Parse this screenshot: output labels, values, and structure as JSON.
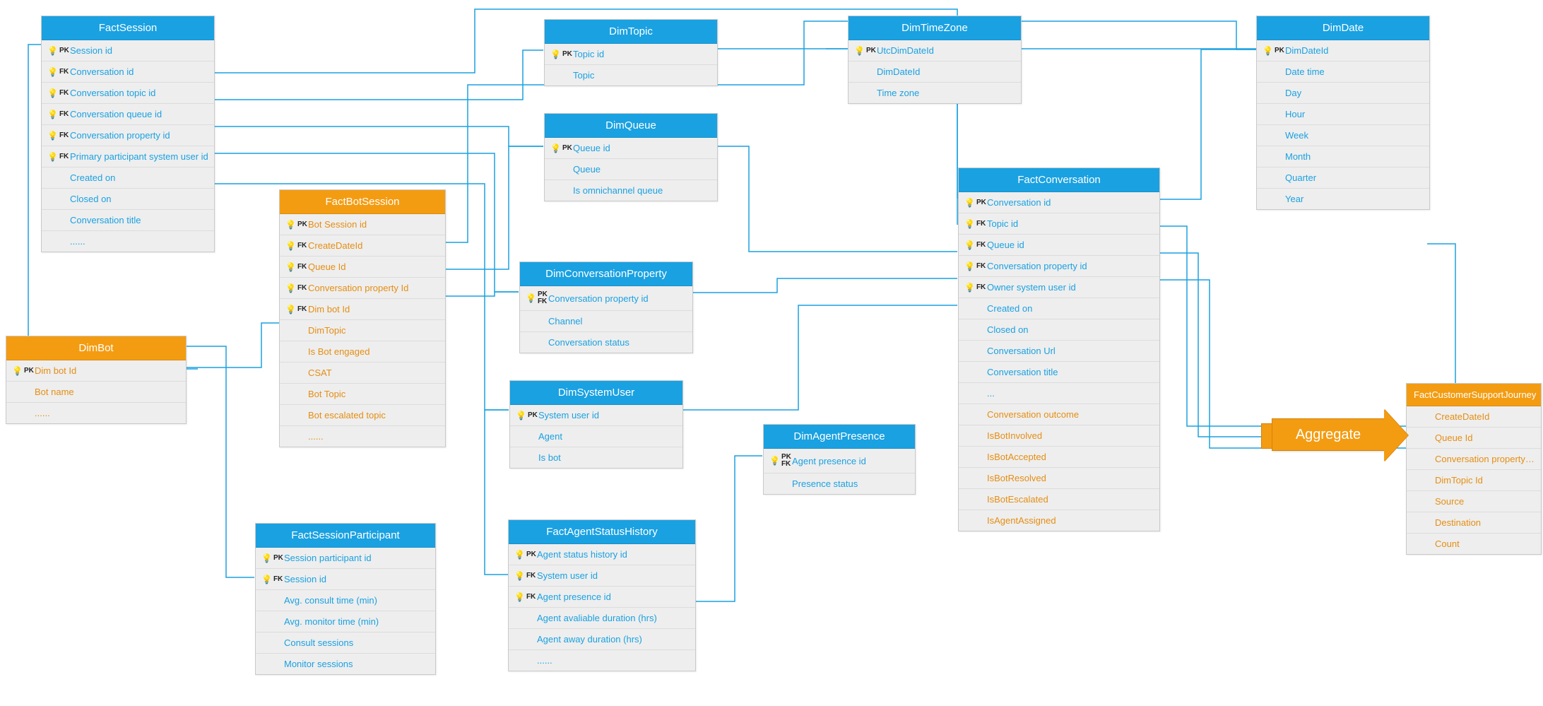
{
  "aggregate_label": "Aggregate",
  "entities": {
    "factSession": {
      "title": "FactSession",
      "color": "blue",
      "rows": [
        {
          "key": "PK",
          "label": "Session id"
        },
        {
          "key": "FK",
          "label": "Conversation id"
        },
        {
          "key": "FK",
          "label": "Conversation topic id"
        },
        {
          "key": "FK",
          "label": "Conversation queue id"
        },
        {
          "key": "FK",
          "label": "Conversation property id"
        },
        {
          "key": "FK",
          "label": "Primary participant system user id"
        },
        {
          "key": "",
          "label": "Created on"
        },
        {
          "key": "",
          "label": "Closed on"
        },
        {
          "key": "",
          "label": "Conversation title"
        },
        {
          "key": "",
          "label": "......"
        }
      ]
    },
    "dimBot": {
      "title": "DimBot",
      "color": "orange",
      "rows": [
        {
          "key": "PK",
          "label": "Dim bot Id"
        },
        {
          "key": "",
          "label": "Bot name"
        },
        {
          "key": "",
          "label": "......"
        }
      ]
    },
    "factBotSession": {
      "title": "FactBotSession",
      "color": "orange",
      "rows": [
        {
          "key": "PK",
          "label": "Bot Session id"
        },
        {
          "key": "FK",
          "label": "CreateDateId"
        },
        {
          "key": "FK",
          "label": "Queue Id"
        },
        {
          "key": "FK",
          "label": "Conversation property Id"
        },
        {
          "key": "FK",
          "label": "Dim bot Id"
        },
        {
          "key": "",
          "label": "DimTopic"
        },
        {
          "key": "",
          "label": "Is Bot engaged"
        },
        {
          "key": "",
          "label": "CSAT"
        },
        {
          "key": "",
          "label": "Bot Topic"
        },
        {
          "key": "",
          "label": "Bot escalated topic"
        },
        {
          "key": "",
          "label": "......"
        }
      ]
    },
    "factSessionParticipant": {
      "title": "FactSessionParticipant",
      "color": "blue",
      "rows": [
        {
          "key": "PK",
          "label": "Session participant id"
        },
        {
          "key": "FK",
          "label": "Session id"
        },
        {
          "key": "",
          "label": "Avg. consult time (min)"
        },
        {
          "key": "",
          "label": "Avg. monitor time (min)"
        },
        {
          "key": "",
          "label": "Consult sessions"
        },
        {
          "key": "",
          "label": "Monitor sessions"
        }
      ]
    },
    "dimTopic": {
      "title": "DimTopic",
      "color": "blue",
      "rows": [
        {
          "key": "PK",
          "label": "Topic id"
        },
        {
          "key": "",
          "label": "Topic"
        }
      ]
    },
    "dimQueue": {
      "title": "DimQueue",
      "color": "blue",
      "rows": [
        {
          "key": "PK",
          "label": "Queue id"
        },
        {
          "key": "",
          "label": "Queue"
        },
        {
          "key": "",
          "label": "Is omnichannel queue"
        }
      ]
    },
    "dimConversationProperty": {
      "title": "DimConversationProperty",
      "color": "blue",
      "rows": [
        {
          "key": "PK FK",
          "label": "Conversation property id"
        },
        {
          "key": "",
          "label": "Channel"
        },
        {
          "key": "",
          "label": "Conversation status"
        }
      ]
    },
    "dimSystemUser": {
      "title": "DimSystemUser",
      "color": "blue",
      "rows": [
        {
          "key": "PK",
          "label": "System user id"
        },
        {
          "key": "",
          "label": "Agent"
        },
        {
          "key": "",
          "label": "Is bot"
        }
      ]
    },
    "factAgentStatusHistory": {
      "title": "FactAgentStatusHistory",
      "color": "blue",
      "rows": [
        {
          "key": "PK",
          "label": "Agent status history id"
        },
        {
          "key": "FK",
          "label": "System user id"
        },
        {
          "key": "FK",
          "label": "Agent presence id"
        },
        {
          "key": "",
          "label": "Agent avaliable duration (hrs)"
        },
        {
          "key": "",
          "label": "Agent away duration (hrs)"
        },
        {
          "key": "",
          "label": "......"
        }
      ]
    },
    "dimAgentPresence": {
      "title": "DimAgentPresence",
      "color": "blue",
      "rows": [
        {
          "key": "PK FK",
          "label": "Agent presence id"
        },
        {
          "key": "",
          "label": "Presence status"
        }
      ]
    },
    "dimTimeZone": {
      "title": "DimTimeZone",
      "color": "blue",
      "rows": [
        {
          "key": "PK",
          "label": "UtcDimDateId"
        },
        {
          "key": "",
          "label": "DimDateId"
        },
        {
          "key": "",
          "label": "Time zone"
        }
      ]
    },
    "factConversation": {
      "title": "FactConversation",
      "color": "blue",
      "rows": [
        {
          "key": "PK",
          "label": "Conversation id",
          "txt": "blue"
        },
        {
          "key": "FK",
          "label": "Topic id",
          "txt": "blue"
        },
        {
          "key": "FK",
          "label": "Queue id",
          "txt": "blue"
        },
        {
          "key": "FK",
          "label": "Conversation property id",
          "txt": "blue"
        },
        {
          "key": "FK",
          "label": "Owner system user id",
          "txt": "blue"
        },
        {
          "key": "",
          "label": "Created on",
          "txt": "blue"
        },
        {
          "key": "",
          "label": "Closed on",
          "txt": "blue"
        },
        {
          "key": "",
          "label": "Conversation Url",
          "txt": "blue"
        },
        {
          "key": "",
          "label": "Conversation title",
          "txt": "blue"
        },
        {
          "key": "",
          "label": "...",
          "txt": "blue"
        },
        {
          "key": "",
          "label": "Conversation outcome",
          "txt": "orange"
        },
        {
          "key": "",
          "label": "IsBotInvolved",
          "txt": "orange"
        },
        {
          "key": "",
          "label": "IsBotAccepted",
          "txt": "orange"
        },
        {
          "key": "",
          "label": "IsBotResolved",
          "txt": "orange"
        },
        {
          "key": "",
          "label": "IsBotEscalated",
          "txt": "orange"
        },
        {
          "key": "",
          "label": "IsAgentAssigned",
          "txt": "orange"
        }
      ]
    },
    "dimDate": {
      "title": "DimDate",
      "color": "blue",
      "rows": [
        {
          "key": "PK",
          "label": "DimDateId"
        },
        {
          "key": "",
          "label": "Date time"
        },
        {
          "key": "",
          "label": "Day"
        },
        {
          "key": "",
          "label": "Hour"
        },
        {
          "key": "",
          "label": "Week"
        },
        {
          "key": "",
          "label": "Month"
        },
        {
          "key": "",
          "label": "Quarter"
        },
        {
          "key": "",
          "label": "Year"
        }
      ]
    },
    "factCustomerSupportJourney": {
      "title": "FactCustomerSupportJourney",
      "color": "orange",
      "rows": [
        {
          "key": "",
          "label": "CreateDateId"
        },
        {
          "key": "",
          "label": "Queue Id"
        },
        {
          "key": "",
          "label": "Conversation property Id"
        },
        {
          "key": "",
          "label": "DimTopic Id"
        },
        {
          "key": "",
          "label": "Source"
        },
        {
          "key": "",
          "label": "Destination"
        },
        {
          "key": "",
          "label": "Count"
        }
      ]
    }
  }
}
